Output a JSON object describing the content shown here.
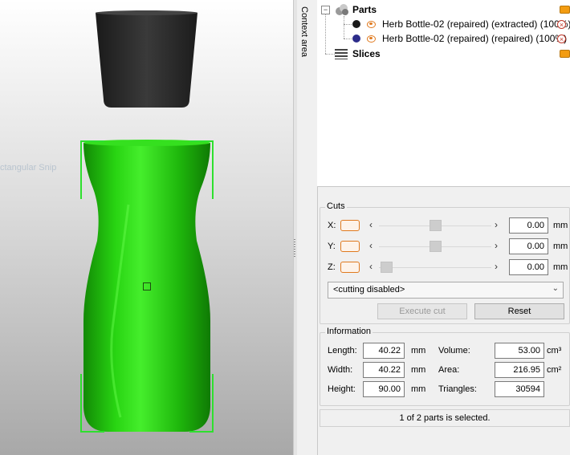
{
  "viewport": {
    "snip_overlay_text": "ctangular Snip",
    "cap_color": "#2b2b2b",
    "body_color": "#22c40f",
    "selection_color": "#2ee02e"
  },
  "context_area": {
    "label": "Context area"
  },
  "tree": {
    "parts_label": "Parts",
    "items": [
      {
        "label": "Herb Bottle-02 (repaired) (extracted) (100%)",
        "dot_color": "#1a1a1a"
      },
      {
        "label": "Herb Bottle-02 (repaired) (repaired) (100%)",
        "dot_color": "#2c2c8a"
      }
    ],
    "slices_label": "Slices"
  },
  "cuts": {
    "title": "Cuts",
    "axes": [
      {
        "label": "X:",
        "value": "0.00",
        "unit": "mm",
        "slider_pos": 0.5
      },
      {
        "label": "Y:",
        "value": "0.00",
        "unit": "mm",
        "slider_pos": 0.5
      },
      {
        "label": "Z:",
        "value": "0.00",
        "unit": "mm",
        "slider_pos": 0.0
      }
    ],
    "mode_select": "<cutting disabled>",
    "execute_label": "Execute cut",
    "reset_label": "Reset"
  },
  "information": {
    "title": "Information",
    "length_label": "Length:",
    "length_value": "40.22",
    "length_unit": "mm",
    "width_label": "Width:",
    "width_value": "40.22",
    "width_unit": "mm",
    "height_label": "Height:",
    "height_value": "90.00",
    "height_unit": "mm",
    "volume_label": "Volume:",
    "volume_value": "53.00",
    "volume_unit": "cm³",
    "area_label": "Area:",
    "area_value": "216.95",
    "area_unit": "cm²",
    "triangles_label": "Triangles:",
    "triangles_value": "30594"
  },
  "status": {
    "text": "1 of 2 parts is selected."
  }
}
